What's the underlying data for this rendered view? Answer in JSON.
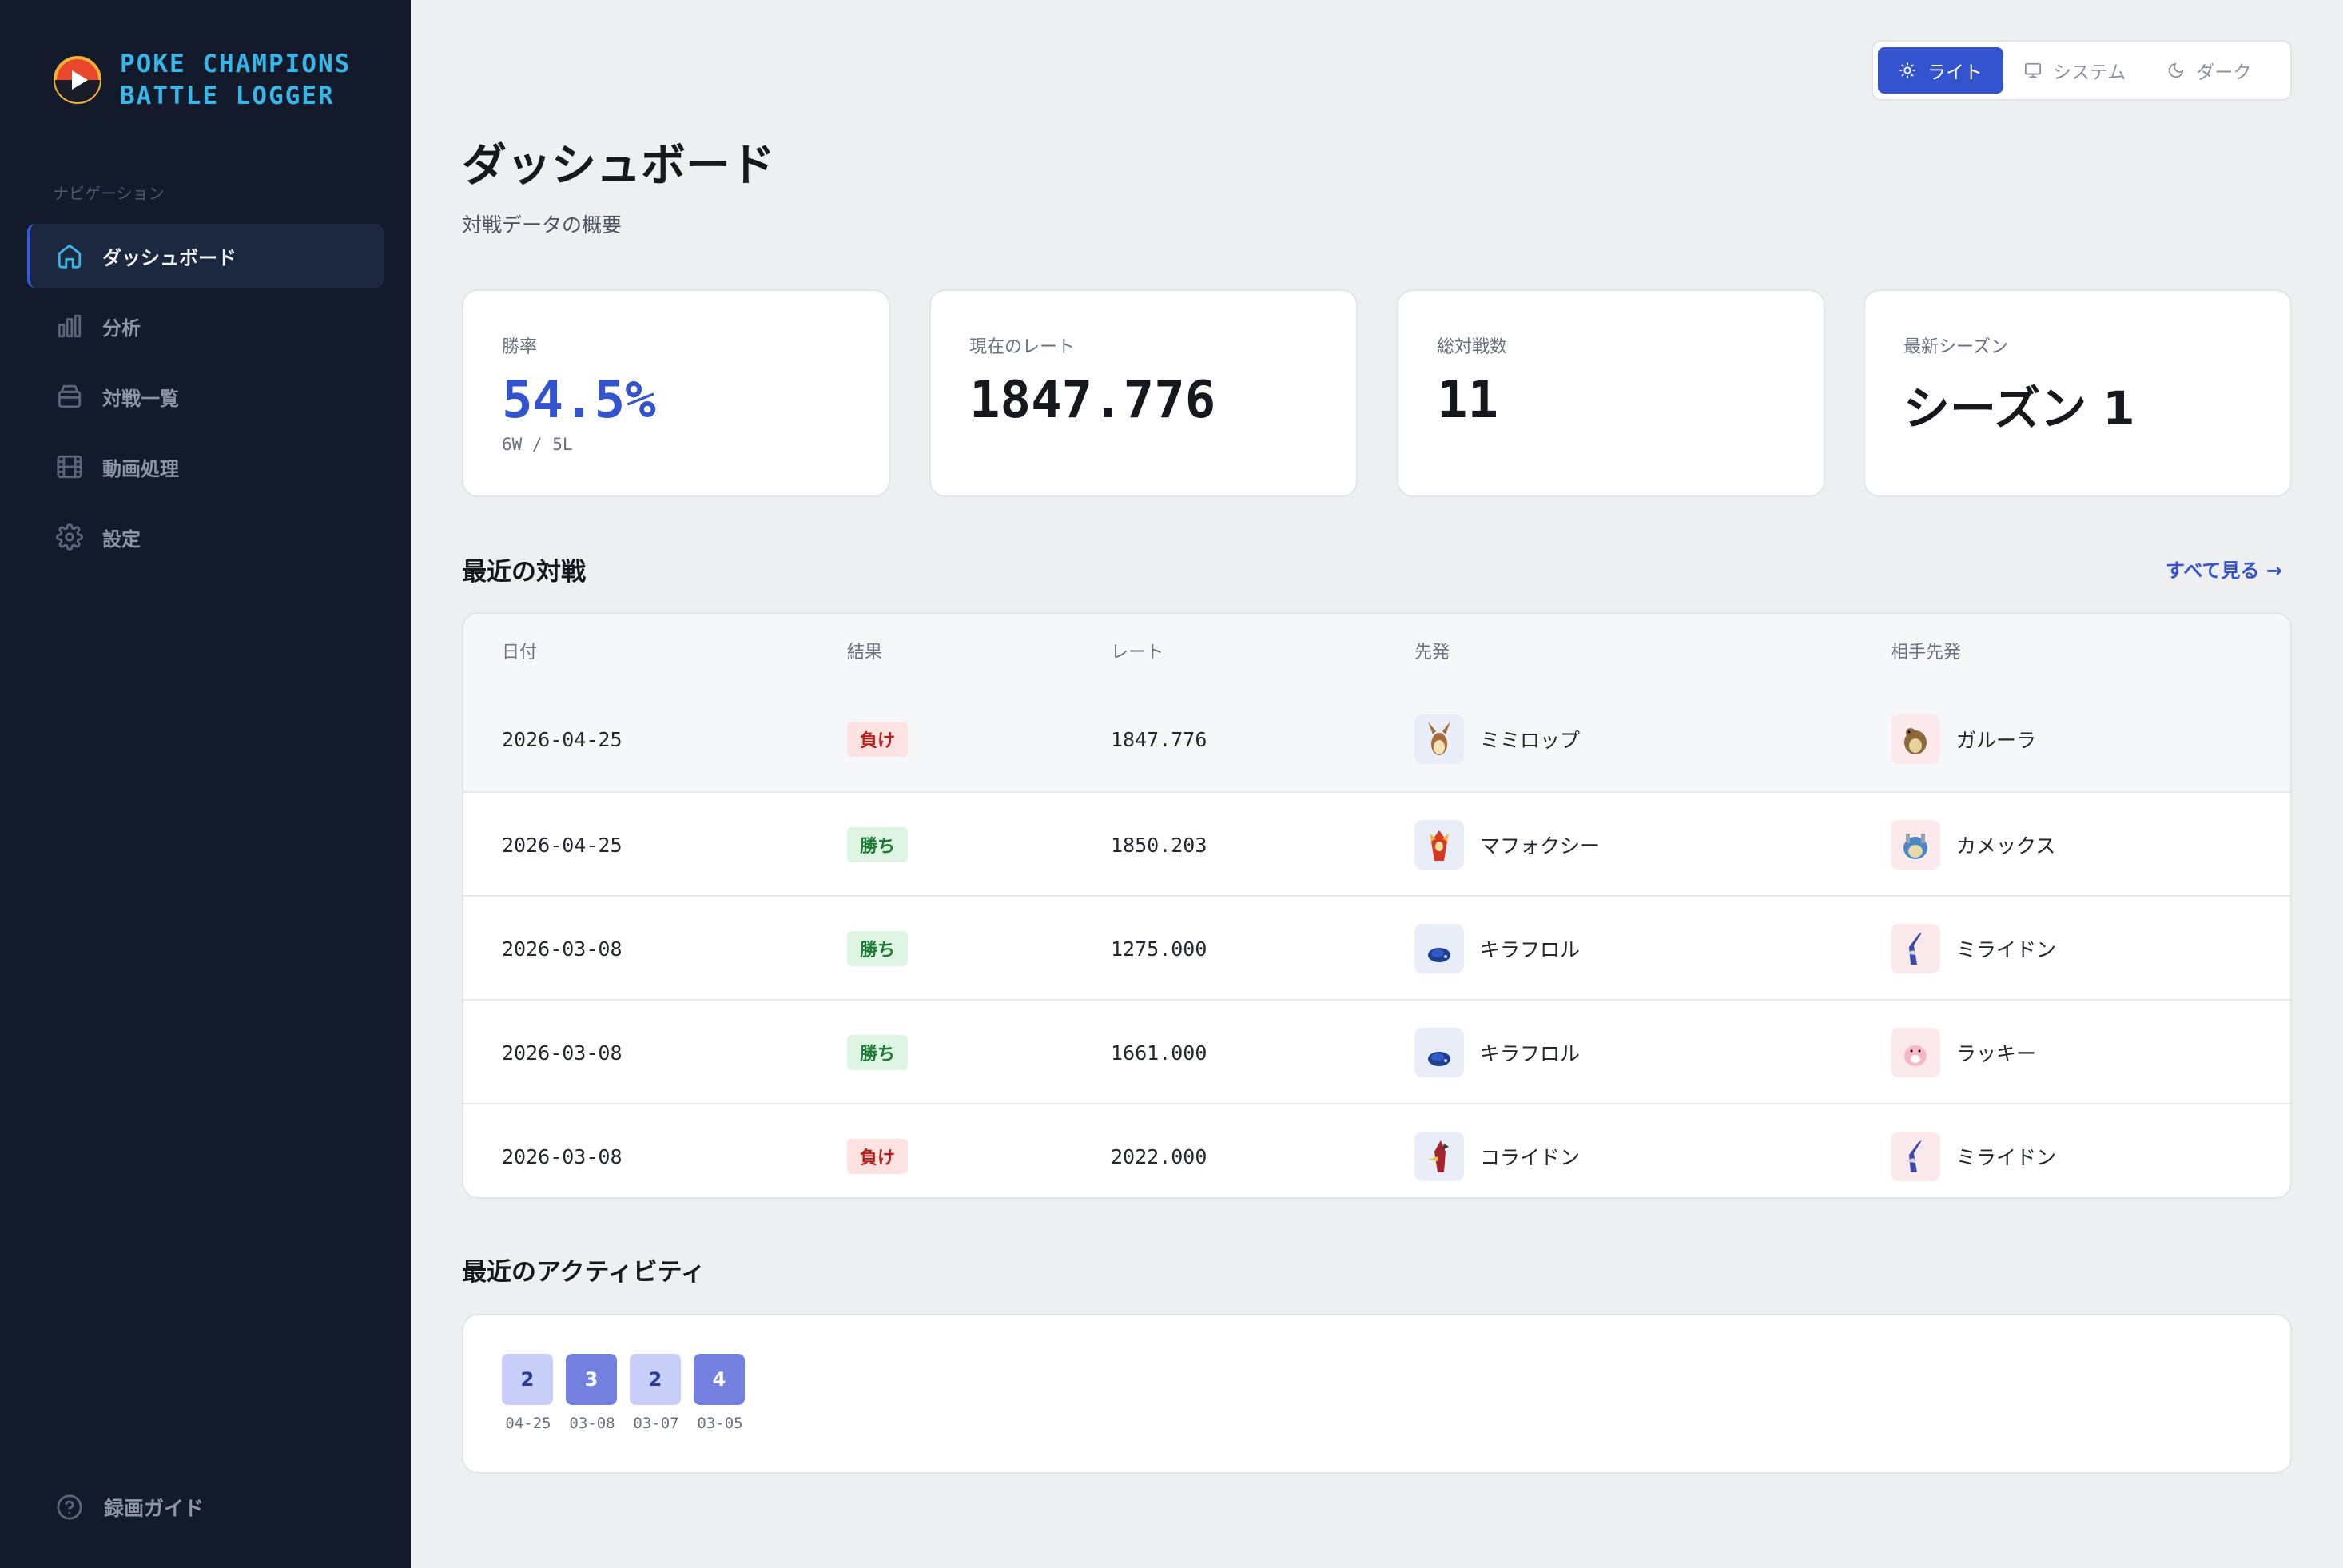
{
  "app": {
    "brand_line1": "POKE CHAMPIONS",
    "brand_line2": "BATTLE LOGGER"
  },
  "sidebar": {
    "heading": "ナビゲーション",
    "items": [
      {
        "label": "ダッシュボード",
        "icon": "home-icon",
        "active": true
      },
      {
        "label": "分析",
        "icon": "bar-chart-icon"
      },
      {
        "label": "対戦一覧",
        "icon": "archive-icon"
      },
      {
        "label": "動画処理",
        "icon": "film-icon"
      },
      {
        "label": "設定",
        "icon": "gear-icon"
      }
    ],
    "guide_label": "録画ガイド",
    "guide_icon": "help-circle-icon"
  },
  "theme": {
    "options": [
      {
        "label": "ライト",
        "icon": "sun-icon",
        "active": true
      },
      {
        "label": "システム",
        "icon": "monitor-icon"
      },
      {
        "label": "ダーク",
        "icon": "moon-icon"
      }
    ]
  },
  "page": {
    "title": "ダッシュボード",
    "subtitle": "対戦データの概要"
  },
  "stats": [
    {
      "label": "勝率",
      "value": "54.5%",
      "sub": "6W / 5L"
    },
    {
      "label": "現在のレート",
      "value": "1847.776"
    },
    {
      "label": "総対戦数",
      "value": "11"
    },
    {
      "label": "最新シーズン",
      "value": "シーズン 1"
    }
  ],
  "recent": {
    "title": "最近の対戦",
    "see_all": "すべて見る →",
    "headers": [
      "日付",
      "結果",
      "レート",
      "先発",
      "相手先発"
    ],
    "rows": [
      {
        "date": "2026-04-25",
        "result": "負け",
        "result_type": "lose",
        "rate": "1847.776",
        "lead": "ミミロップ",
        "opp": "ガルーラ"
      },
      {
        "date": "2026-04-25",
        "result": "勝ち",
        "result_type": "win",
        "rate": "1850.203",
        "lead": "マフォクシー",
        "opp": "カメックス"
      },
      {
        "date": "2026-03-08",
        "result": "勝ち",
        "result_type": "win",
        "rate": "1275.000",
        "lead": "キラフロル",
        "opp": "ミライドン"
      },
      {
        "date": "2026-03-08",
        "result": "勝ち",
        "result_type": "win",
        "rate": "1661.000",
        "lead": "キラフロル",
        "opp": "ラッキー"
      },
      {
        "date": "2026-03-08",
        "result": "負け",
        "result_type": "lose",
        "rate": "2022.000",
        "lead": "コライドン",
        "opp": "ミライドン"
      }
    ]
  },
  "activity": {
    "title": "最近のアクティビティ",
    "days": [
      {
        "count": "2",
        "date": "04-25"
      },
      {
        "count": "3",
        "date": "03-08"
      },
      {
        "count": "2",
        "date": "03-07"
      },
      {
        "count": "4",
        "date": "03-05"
      }
    ]
  },
  "colors": {
    "sidebar_bg": "#121a2b",
    "accent": "#3353cf",
    "brand_cyan": "#38b6e8",
    "win": "#1e7a36",
    "lose": "#b4221d"
  }
}
